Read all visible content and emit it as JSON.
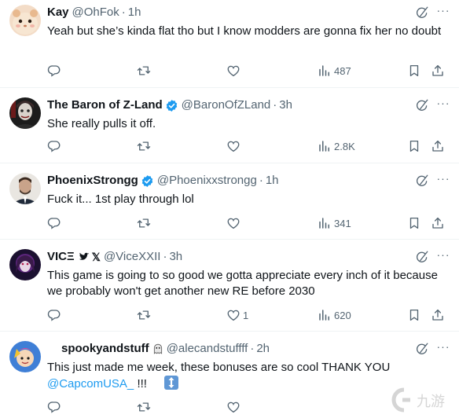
{
  "tweets": [
    {
      "name": "Kay",
      "handle": "@OhFok",
      "time": "1h",
      "text": "Yeah but she’s kinda flat tho but I know modders are gonna fix her no doubt",
      "views": "487",
      "likes": ""
    },
    {
      "name": "The Baron of Z-Land",
      "handle": "@BaronOfZLand",
      "time": "3h",
      "text": "She really pulls it off.",
      "views": "2.8K",
      "likes": ""
    },
    {
      "name": "PhoenixStrongg",
      "handle": "@Phoenixxstrongg",
      "time": "1h",
      "text": "Fuck it... 1st play through lol",
      "views": "341",
      "likes": ""
    },
    {
      "name": "VICΞ",
      "handle": "@ViceXXII",
      "time": "3h",
      "text": "This game is going to so good we gotta appreciate every inch of it because we probably won't get another new RE before 2030",
      "views": "620",
      "likes": "1"
    },
    {
      "name": "spookyandstuff",
      "handle": "@alecandstuffff",
      "time": "2h",
      "text": "This just made me week, these bonuses are so cool THANK YOU",
      "mention": "@CapcomUSA_",
      "text_tail": " !!!",
      "views": "",
      "likes": ""
    }
  ],
  "colors": {
    "verified": "#1d9bf0",
    "icon_gray": "#536471",
    "link": "#1d9bf0",
    "divider": "#eff3f4"
  },
  "icons": [
    "reply-icon",
    "retweet-icon",
    "like-icon",
    "views-icon",
    "bookmark-icon",
    "share-icon",
    "grok-icon",
    "more-icon",
    "verified-icon"
  ]
}
